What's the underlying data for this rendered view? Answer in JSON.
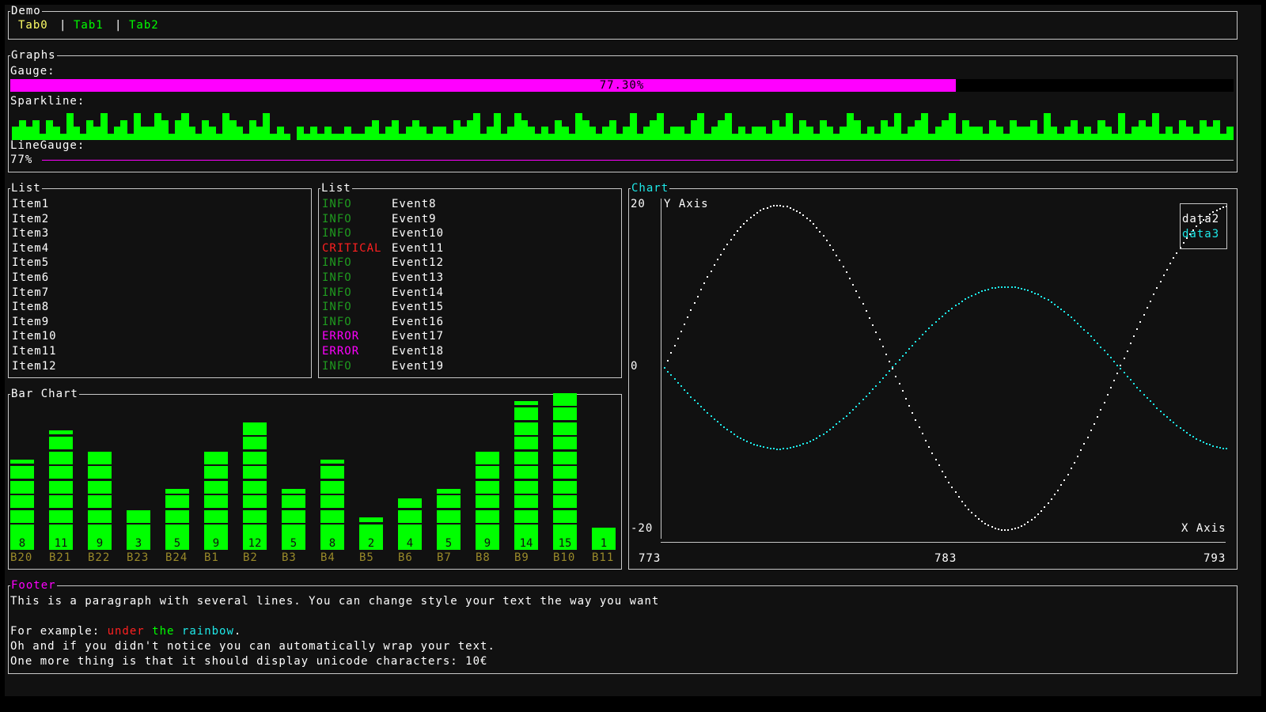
{
  "tabs_panel": {
    "title": "Demo",
    "tabs": [
      {
        "label": "Tab0",
        "selected": true
      },
      {
        "label": "Tab1",
        "selected": false
      },
      {
        "label": "Tab2",
        "selected": false
      }
    ]
  },
  "graphs": {
    "title": "Graphs",
    "gauge": {
      "title": "Gauge:",
      "value": 0.773,
      "label": "77.30%",
      "color": "#ff00ff"
    },
    "sparkline": {
      "title": "Sparkline:",
      "color": "#00ff00",
      "values": [
        2,
        3,
        2,
        3,
        1,
        3,
        2,
        1,
        4,
        2,
        1,
        3,
        2,
        4,
        1,
        2,
        3,
        1,
        4,
        2,
        2,
        4,
        3,
        1,
        3,
        4,
        2,
        1,
        3,
        2,
        1,
        4,
        3,
        2,
        1,
        3,
        2,
        4,
        1,
        2,
        1,
        0,
        2,
        1,
        2,
        1,
        2,
        1,
        1,
        2,
        1,
        1,
        2,
        3,
        1,
        2,
        3,
        1,
        2,
        3,
        2,
        1,
        2,
        2,
        1,
        3,
        2,
        3,
        4,
        1,
        2,
        4,
        1,
        2,
        4,
        3,
        2,
        1,
        2,
        1,
        3,
        2,
        1,
        4,
        3,
        2,
        1,
        2,
        3,
        1,
        2,
        4,
        1,
        2,
        3,
        4,
        1,
        2,
        2,
        1,
        3,
        4,
        1,
        2,
        3,
        4,
        1,
        2,
        1,
        2,
        2,
        1,
        3,
        2,
        4,
        1,
        3,
        2,
        1,
        3,
        2,
        1,
        2,
        4,
        3,
        1,
        2,
        1,
        3,
        2,
        4,
        1,
        2,
        3,
        4,
        1,
        2,
        3,
        4,
        1,
        3,
        2,
        2,
        1,
        3,
        2,
        1,
        3,
        2,
        2,
        3,
        1,
        4,
        2,
        1,
        2,
        3,
        1,
        2,
        1,
        3,
        2,
        1,
        4,
        1,
        2,
        3,
        2,
        4,
        1,
        2,
        1,
        3,
        2,
        1,
        3,
        2,
        3,
        1,
        2
      ]
    },
    "line_gauge": {
      "title": "LineGauge:",
      "label": "77%",
      "value": 0.77,
      "color": "#ff00ff"
    }
  },
  "list_items": {
    "title": "List",
    "items": [
      "Item1",
      "Item2",
      "Item3",
      "Item4",
      "Item5",
      "Item6",
      "Item7",
      "Item8",
      "Item9",
      "Item10",
      "Item11",
      "Item12"
    ]
  },
  "list_events": {
    "title": "List",
    "items": [
      {
        "level": "INFO",
        "event": "Event8"
      },
      {
        "level": "INFO",
        "event": "Event9"
      },
      {
        "level": "INFO",
        "event": "Event10"
      },
      {
        "level": "CRITICAL",
        "event": "Event11"
      },
      {
        "level": "INFO",
        "event": "Event12"
      },
      {
        "level": "INFO",
        "event": "Event13"
      },
      {
        "level": "INFO",
        "event": "Event14"
      },
      {
        "level": "INFO",
        "event": "Event15"
      },
      {
        "level": "INFO",
        "event": "Event16"
      },
      {
        "level": "ERROR",
        "event": "Event17"
      },
      {
        "level": "ERROR",
        "event": "Event18"
      },
      {
        "level": "INFO",
        "event": "Event19"
      }
    ],
    "level_colors": {
      "INFO": "#1f9a1f",
      "CRITICAL": "#ff2020",
      "ERROR": "#ff00ff"
    }
  },
  "bar_chart": {
    "title": "Bar Chart",
    "chart_data": {
      "type": "bar",
      "categories": [
        "B20",
        "B21",
        "B22",
        "B23",
        "B24",
        "B1",
        "B2",
        "B3",
        "B4",
        "B5",
        "B6",
        "B7",
        "B8",
        "B9",
        "B10",
        "B11"
      ],
      "values": [
        8,
        11,
        9,
        3,
        5,
        9,
        12,
        5,
        8,
        2,
        4,
        5,
        9,
        14,
        15,
        1
      ],
      "bar_color": "#00ff00",
      "label_color": "#9a8a2a"
    }
  },
  "chart": {
    "title": "Chart",
    "chart_data": {
      "type": "scatter",
      "ylabel": "Y Axis",
      "xlabel": "X Axis",
      "y_ticks": [
        "20",
        "0",
        "-20"
      ],
      "x_ticks": [
        "773",
        "783",
        "793"
      ],
      "xlim": [
        773,
        793
      ],
      "ylim": [
        -20,
        20
      ],
      "series": [
        {
          "name": "data2",
          "color": "#ffffff",
          "func": "sin",
          "amplitude": 20,
          "period": 16.2,
          "phase": 0
        },
        {
          "name": "data3",
          "color": "#1ee8e8",
          "func": "sin",
          "amplitude": 10,
          "period": 16.2,
          "phase": 3.14159
        }
      ],
      "legend": "top-right"
    }
  },
  "footer": {
    "title": "Footer",
    "line1": "This is a paragraph with several lines. You can change style your text the way you want",
    "line2_prefix": "For example: ",
    "word_under": "under",
    "word_the": "the",
    "word_rainbow": "rainbow",
    "line2_suffix": ".",
    "line3": "Oh and if you didn't notice you can automatically wrap your text.",
    "line4": "One more thing is that it should display unicode characters: 10€"
  }
}
